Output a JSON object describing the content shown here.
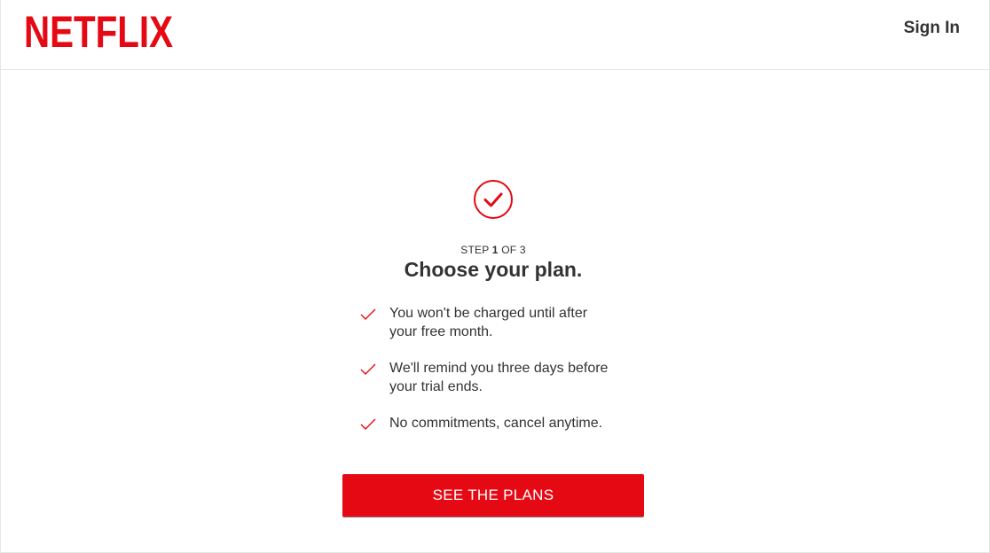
{
  "header": {
    "logo_text": "NETFLIX",
    "signin_label": "Sign In"
  },
  "colors": {
    "brand_red": "#e50914",
    "text_dark": "#333333",
    "divider": "#e6e6e6"
  },
  "step": {
    "prefix": "STEP",
    "current": "1",
    "separator": "OF",
    "total": "3"
  },
  "title": "Choose your plan.",
  "benefits": [
    {
      "icon": "checkmark-icon",
      "line1": "You won't be charged until after",
      "line2": "your free month."
    },
    {
      "icon": "checkmark-icon",
      "line1": "We'll remind you three days before",
      "line2": "your trial ends."
    },
    {
      "icon": "checkmark-icon",
      "line1": "No commitments, cancel anytime.",
      "line2": ""
    }
  ],
  "cta_label": "SEE THE PLANS",
  "icons": {
    "badge": "check-circle-icon"
  }
}
